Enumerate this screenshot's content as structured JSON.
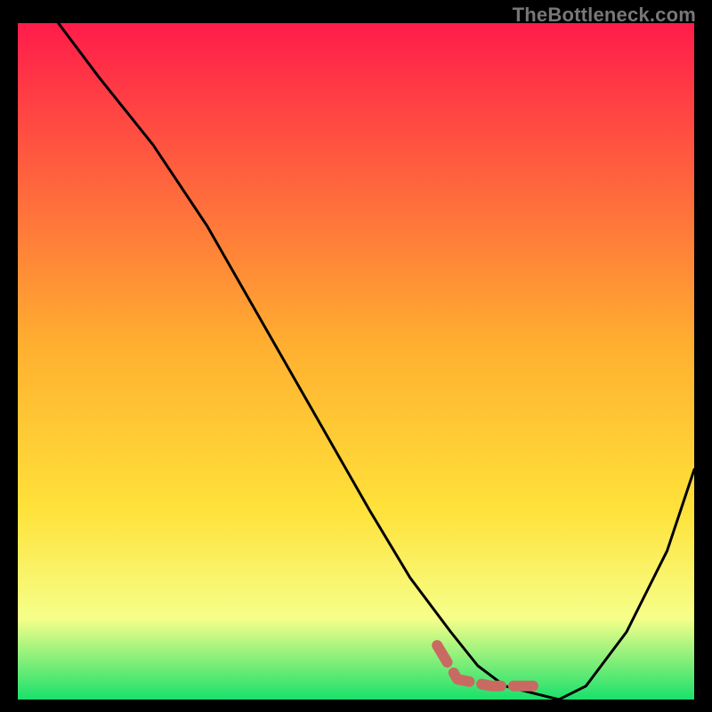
{
  "watermark": "TheBottleneck.com",
  "colors": {
    "page_bg": "#000000",
    "gradient_top": "#ff1c4a",
    "gradient_mid": "#ffe23a",
    "gradient_low": "#f6ff8a",
    "gradient_bottom": "#19e06b",
    "curve": "#000000",
    "dash_stroke": "#c96a62"
  },
  "chart_data": {
    "type": "line",
    "title": "",
    "xlabel": "",
    "ylabel": "",
    "xlim": [
      0,
      100
    ],
    "ylim": [
      0,
      100
    ],
    "series": [
      {
        "name": "bottleneck-curve",
        "x": [
          6,
          12,
          20,
          28,
          36,
          44,
          52,
          58,
          64,
          68,
          72,
          76,
          80,
          84,
          90,
          96,
          100
        ],
        "y": [
          100,
          92,
          82,
          70,
          56,
          42,
          28,
          18,
          10,
          5,
          2,
          1,
          0,
          2,
          10,
          22,
          34
        ]
      }
    ],
    "annotations": [
      {
        "name": "dashed-marker",
        "kind": "polyline-dashed",
        "x": [
          62,
          65,
          70,
          74,
          78
        ],
        "y": [
          8,
          3,
          2,
          2,
          2
        ]
      }
    ]
  }
}
